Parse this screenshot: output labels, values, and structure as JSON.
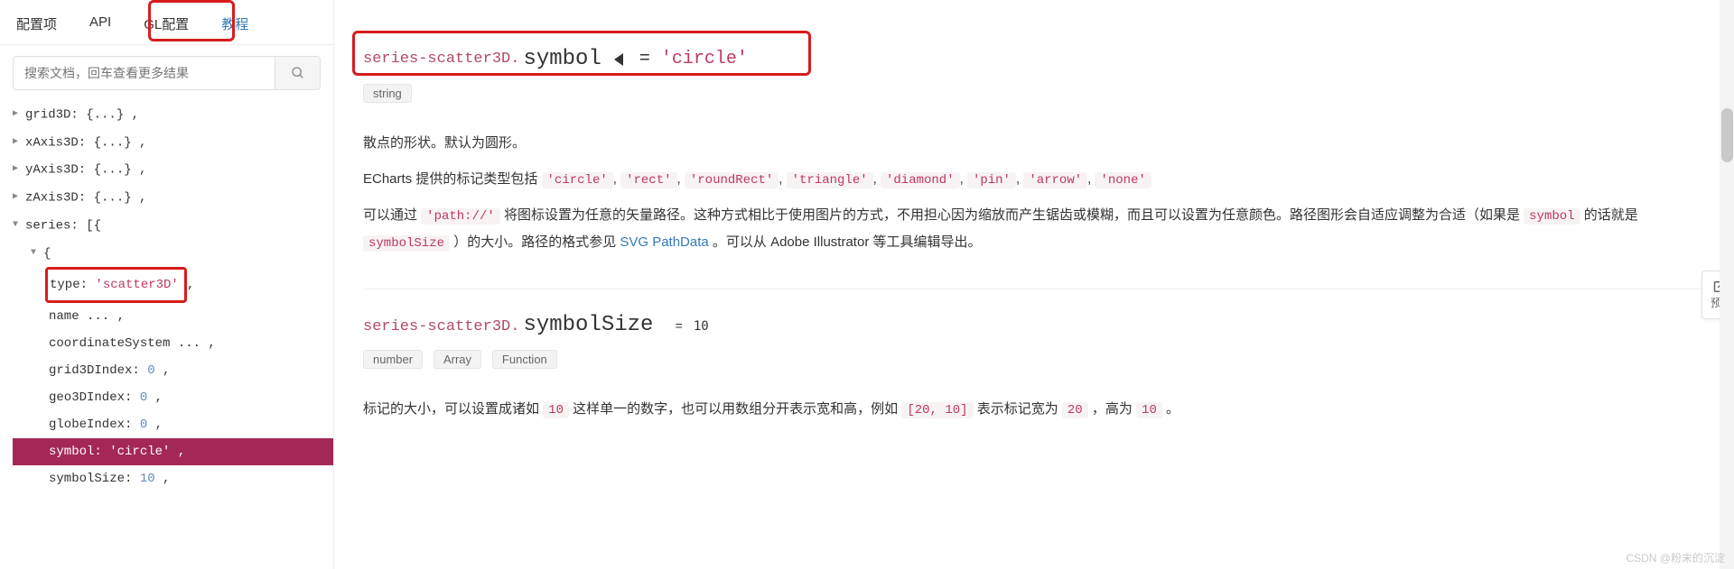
{
  "tabs": {
    "config": "配置项",
    "api": "API",
    "gl": "GL配置",
    "tutorial": "教程"
  },
  "search": {
    "placeholder": "搜索文档，回车查看更多结果"
  },
  "tree": {
    "grid3D": "grid3D: {...} ,",
    "xAxis3D": "xAxis3D: {...} ,",
    "yAxis3D": "yAxis3D: {...} ,",
    "zAxis3D": "zAxis3D: {...} ,",
    "series": "series: [{",
    "brace": "{",
    "type_key": "type: ",
    "type_val": "'scatter3D'",
    "type_comma": ",",
    "name": "name ... ,",
    "coord": "coordinateSystem ... ,",
    "g3d_key": "grid3DIndex: ",
    "g3d_val": "0",
    "geo_key": "geo3DIndex: ",
    "geo_val": "0",
    "globe_key": "globeIndex: ",
    "globe_val": "0",
    "symbol_key": "symbol: ",
    "symbol_val": "'circle'",
    "symsize_key": "symbolSize: ",
    "symsize_val": "10",
    "tail": " ,"
  },
  "sec1": {
    "prefix": "series-scatter3D.",
    "name": "symbol",
    "eq": "=",
    "def": "'circle'",
    "types": {
      "t1": "string"
    },
    "p1": "散点的形状。默认为圆形。",
    "p2_a": "ECharts 提供的标记类型包括 ",
    "circle": "'circle'",
    "rect": "'rect'",
    "roundRect": "'roundRect'",
    "triangle": "'triangle'",
    "diamond": "'diamond'",
    "pin": "'pin'",
    "arrow": "'arrow'",
    "none": "'none'",
    "comma": ", ",
    "p3_a": "可以通过 ",
    "path": "'path://'",
    "p3_b": " 将图标设置为任意的矢量路径。这种方式相比于使用图片的方式，不用担心因为缩放而产生锯齿或模糊，而且可以设置为任意颜色。路径图形会自适应调整为合适（如果是 ",
    "symbol": "symbol",
    "p3_c": " 的话就是 ",
    "symbolSize": "symbolSize",
    "p3_d": " ）的大小。路径的格式参见 ",
    "pathdata": "SVG PathData",
    "p3_e": "。可以从 Adobe Illustrator 等工具编辑导出。"
  },
  "sec2": {
    "prefix": "series-scatter3D.",
    "name": "symbolSize",
    "eq": "=",
    "def": "10",
    "types": {
      "t1": "number",
      "t2": "Array",
      "t3": "Function"
    },
    "p1_a": "标记的大小，可以设置成诸如 ",
    "ten": "10",
    "p1_b": " 这样单一的数字，也可以用数组分开表示宽和高，例如 ",
    "arr": "[20, 10]",
    "p1_c": " 表示标记宽为 ",
    "twenty": "20",
    "p1_d": "，高为 ",
    "ten2": "10",
    "p1_e": " 。"
  },
  "preview": "预览",
  "watermark": "CSDN @粉末的沉淀"
}
